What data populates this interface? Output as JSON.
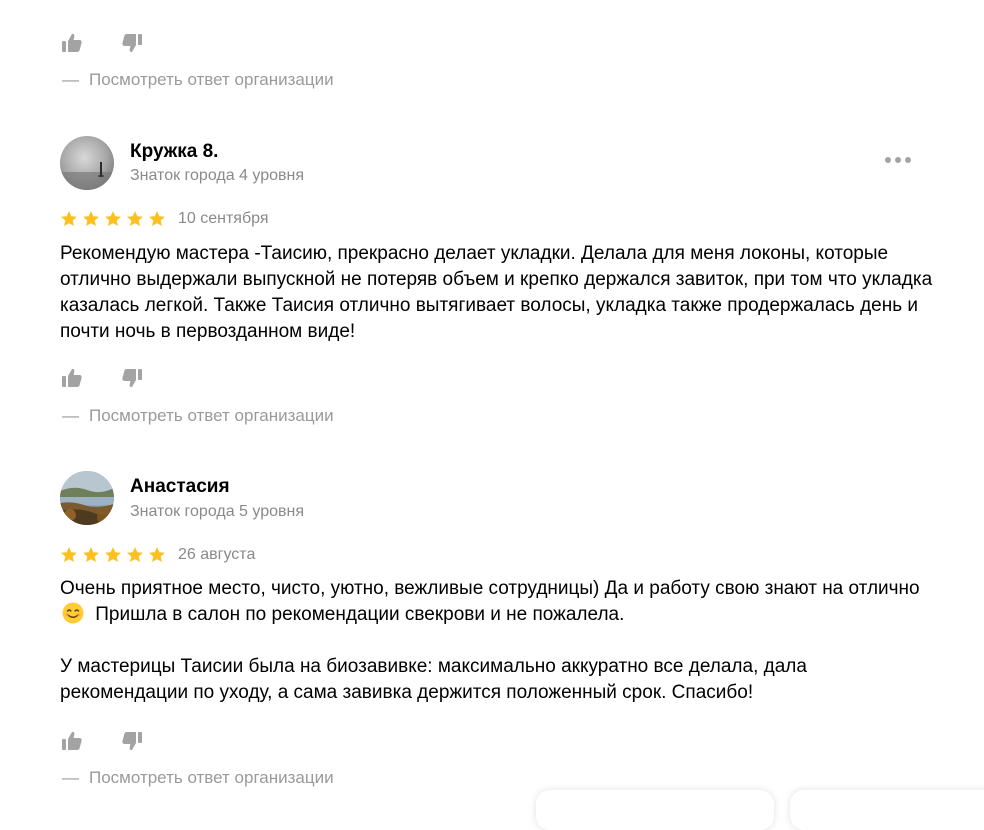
{
  "reply_label": "Посмотреть ответ организации",
  "reply_dash": "—",
  "colors": {
    "star": "#fcc01f",
    "muted_icon": "#a3a3a3",
    "muted_text": "#9a9a9a"
  },
  "top_partial": {
    "reply": "Посмотреть ответ организации"
  },
  "reviews": [
    {
      "author": "Кружка 8.",
      "level": "Знаток города 4 уровня",
      "rating": 5,
      "date": "10 сентября",
      "text_p1": "Рекомендую мастера -Таисию, прекрасно делает укладки. Делала для меня локоны, которые отлично выдержали выпускной не потеряв объем и крепко держался завиток, при том что укладка казалась легкой. Также Таисия отлично вытягивает волосы, укладка также продержалась день и почти ночь в первозданном виде!",
      "reply": "Посмотреть ответ организации",
      "avatar_icon": "avatar-grey-landscape"
    },
    {
      "author": "Анастасия",
      "level": "Знаток города 5 уровня",
      "rating": 5,
      "date": "26 августа",
      "text_p1_a": "Очень приятное место, чисто, уютно, вежливые сотрудницы) Да и работу свою знают на отлично",
      "text_p1_b": " Пришла в салон по рекомендации свекрови и не пожалела.",
      "text_p2": "У мастерицы Таисии была на биозавивке: максимально аккуратно все делала, дала рекомендации по уходу, а сама завивка держится положенный срок. Спасибо!",
      "reply": "Посмотреть ответ организации",
      "avatar_icon": "avatar-autumn-landscape",
      "emoji_icon": "smiling-face-icon"
    }
  ],
  "icons": {
    "like": "thumbs-up-icon",
    "dislike": "thumbs-down-icon",
    "more": "more-dots-icon",
    "star": "star-icon"
  }
}
